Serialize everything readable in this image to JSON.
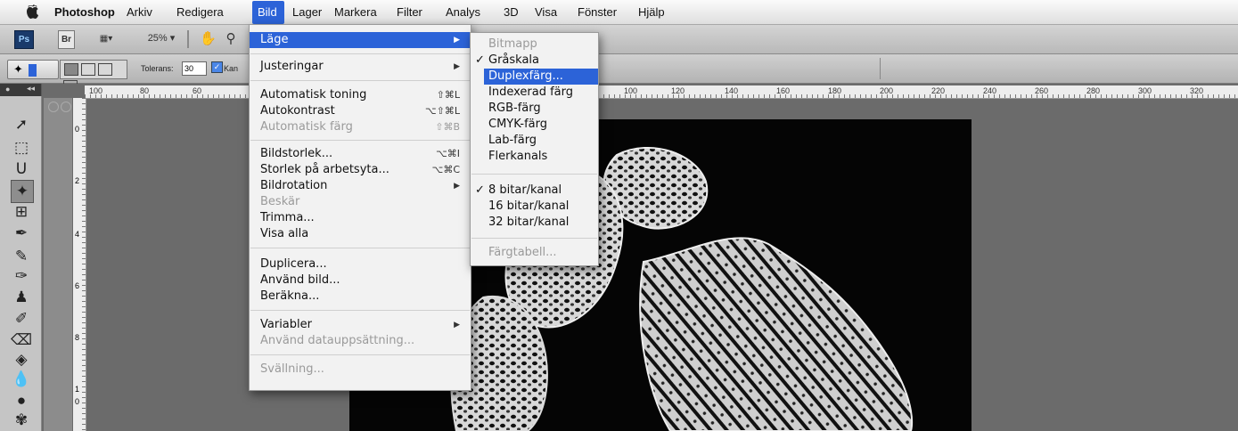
{
  "menubar": {
    "app": "Photoshop",
    "items": [
      "Arkiv",
      "Redigera",
      "Bild",
      "Lager",
      "Markera",
      "Filter",
      "Analys",
      "3D",
      "Visa",
      "Fönster",
      "Hjälp"
    ],
    "active": "Bild"
  },
  "appbar": {
    "ps": "Ps",
    "br": "Br",
    "zoom": "25%"
  },
  "options": {
    "tolerance_label": "Tolerans:",
    "tolerance_value": "30",
    "antialias_label": "Kan"
  },
  "ruler": {
    "top_ticks": [
      "100",
      "80",
      "60",
      "100",
      "120",
      "140",
      "160",
      "180",
      "200",
      "220",
      "240",
      "260",
      "280",
      "300",
      "320"
    ],
    "left_ticks": [
      "0",
      "2",
      "4",
      "6",
      "8",
      "1",
      "0"
    ]
  },
  "bild_menu": {
    "items": [
      {
        "label": "Läge",
        "highlight": true,
        "submenu": true
      },
      {
        "label": "Justeringar",
        "submenu": true
      },
      {
        "label": "Automatisk toning",
        "shortcut": "⇧⌘L"
      },
      {
        "label": "Autokontrast",
        "shortcut": "⌥⇧⌘L"
      },
      {
        "label": "Automatisk färg",
        "shortcut": "⇧⌘B",
        "disabled": true
      },
      {
        "label": "Bildstorlek...",
        "shortcut": "⌥⌘I"
      },
      {
        "label": "Storlek på arbetsyta...",
        "shortcut": "⌥⌘C"
      },
      {
        "label": "Bildrotation",
        "submenu": true
      },
      {
        "label": "Beskär",
        "disabled": true
      },
      {
        "label": "Trimma..."
      },
      {
        "label": "Visa alla"
      },
      {
        "label": "Duplicera..."
      },
      {
        "label": "Använd bild..."
      },
      {
        "label": "Beräkna..."
      },
      {
        "label": "Variabler",
        "submenu": true
      },
      {
        "label": "Använd datauppsättning...",
        "disabled": true
      },
      {
        "label": "Svällning...",
        "disabled": true
      }
    ]
  },
  "lage_submenu": {
    "items": [
      {
        "label": "Bitmapp",
        "disabled": true
      },
      {
        "label": "Gråskala",
        "checked": true
      },
      {
        "label": "Duplexfärg...",
        "highlight": true
      },
      {
        "label": "Indexerad färg"
      },
      {
        "label": "RGB-färg"
      },
      {
        "label": "CMYK-färg"
      },
      {
        "label": "Lab-färg"
      },
      {
        "label": "Flerkanals"
      },
      {
        "label": "8 bitar/kanal",
        "checked": true
      },
      {
        "label": "16 bitar/kanal"
      },
      {
        "label": "32 bitar/kanal"
      },
      {
        "label": "Färgtabell...",
        "disabled": true
      }
    ]
  },
  "colors": {
    "highlight": "#2c63d8",
    "menu_bg": "#f2f2f2"
  }
}
